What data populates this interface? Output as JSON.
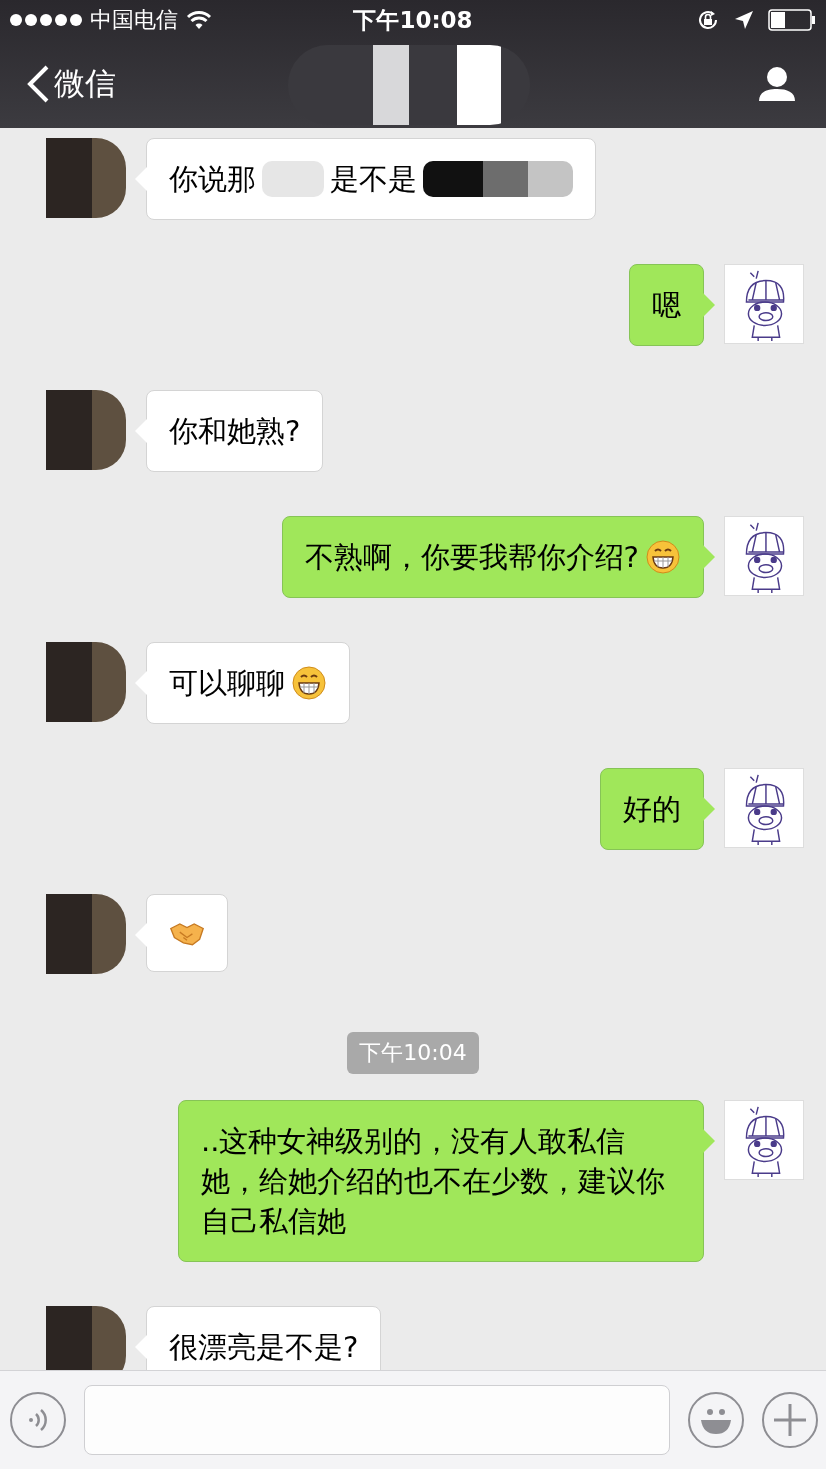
{
  "status_bar": {
    "carrier": "中国电信",
    "time": "下午10:08"
  },
  "nav": {
    "back_label": "微信"
  },
  "messages": [
    {
      "kind": "text",
      "outgoing": false,
      "segments": [
        {
          "kind": "text",
          "text": "你说那"
        },
        {
          "kind": "redacted"
        },
        {
          "kind": "text",
          "text": "是不是"
        },
        {
          "kind": "redacted"
        }
      ]
    },
    {
      "kind": "text",
      "outgoing": true,
      "segments": [
        {
          "kind": "text",
          "text": "嗯"
        }
      ]
    },
    {
      "kind": "text",
      "outgoing": false,
      "segments": [
        {
          "kind": "text",
          "text": "你和她熟?"
        }
      ]
    },
    {
      "kind": "text",
      "outgoing": true,
      "segments": [
        {
          "kind": "text",
          "text": "不熟啊，你要我帮你介绍?"
        },
        {
          "kind": "grin-emoji"
        }
      ]
    },
    {
      "kind": "text",
      "outgoing": false,
      "segments": [
        {
          "kind": "text",
          "text": "可以聊聊"
        },
        {
          "kind": "grin-emoji"
        }
      ]
    },
    {
      "kind": "text",
      "outgoing": true,
      "segments": [
        {
          "kind": "text",
          "text": "好的"
        }
      ]
    },
    {
      "kind": "text",
      "outgoing": false,
      "segments": [
        {
          "kind": "handshake-emoji"
        }
      ]
    },
    {
      "kind": "time",
      "text": "下午10:04"
    },
    {
      "kind": "text",
      "outgoing": true,
      "segments": [
        {
          "kind": "text",
          "text": "..这种女神级别的，没有人敢私信她，给她介绍的也不在少数，建议你自己私信她"
        }
      ]
    },
    {
      "kind": "text",
      "outgoing": false,
      "segments": [
        {
          "kind": "text",
          "text": "很漂亮是不是?"
        }
      ]
    }
  ]
}
